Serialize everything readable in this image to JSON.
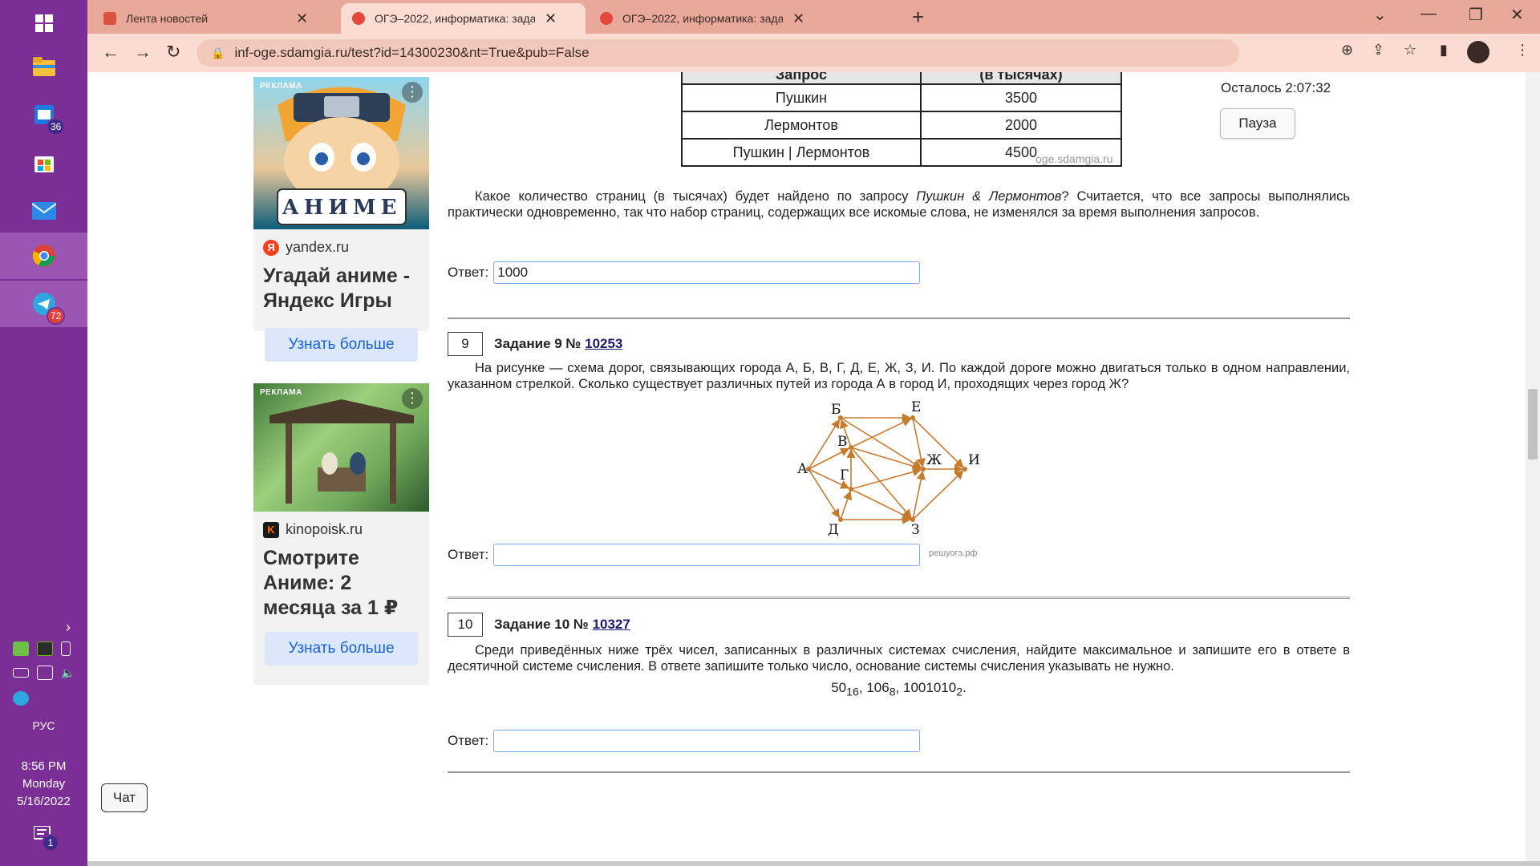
{
  "taskbar": {
    "mail_badge": "36",
    "telegram_badge": "72",
    "notification_badge": "1",
    "language": "РУС",
    "time": "8:56 PM",
    "day": "Monday",
    "date": "5/16/2022"
  },
  "browser": {
    "tabs": [
      {
        "title": "Лента новостей",
        "active": false
      },
      {
        "title": "ОГЭ–2022, информатика: задания",
        "active": true
      },
      {
        "title": "ОГЭ–2022, информатика: задания",
        "active": false
      }
    ],
    "url": "inf-oge.sdamgia.ru/test?id=14300230&nt=True&pub=False"
  },
  "ads": [
    {
      "tag": "РЕКЛАМА",
      "image_text": "АНИМЕ",
      "source": "yandex.ru",
      "title": "Угадай аниме - Яндекс Игры",
      "button": "Узнать больше"
    },
    {
      "tag": "РЕКЛАМА",
      "source": "kinopoisk.ru",
      "title": "Смотрите Аниме: 2 месяца за 1 ₽",
      "button": "Узнать больше"
    }
  ],
  "timer": {
    "label": "Осталось 2:07:32",
    "pause_button": "Пауза"
  },
  "task8": {
    "table_header": [
      "Запрос",
      "(в тысячах)"
    ],
    "rows": [
      [
        "Пушкин",
        "3500"
      ],
      [
        "Лермонтов",
        "2000"
      ],
      [
        "Пушкин | Лермонтов",
        "4500"
      ]
    ],
    "watermark": "oge.sdamgia.ru",
    "question_a": "Какое количество страниц (в тысячах) будет найдено по запросу ",
    "question_em": "Пушкин & Лермонтов",
    "question_b": "? Считается, что все запросы выполнялись практически одновременно, так что набор страниц, содержащих все искомые слова, не изменялся за время выполнения запросов.",
    "answer_label": "Ответ:",
    "answer_value": "1000"
  },
  "task9": {
    "number": "9",
    "title": "Задание 9 № ",
    "id": "10253",
    "text": "На рисунке — схема дорог, связывающих города А, Б, В, Г, Д, Е, Ж, З, И. По каждой дороге можно двигаться только в одном направлении, указанном стрелкой. Сколько существует различных путей из города А в город И, проходящих через город Ж?",
    "graph_nodes": [
      "А",
      "Б",
      "В",
      "Г",
      "Д",
      "Е",
      "Ж",
      "З",
      "И"
    ],
    "graph_edges": [
      [
        "А",
        "Б"
      ],
      [
        "А",
        "В"
      ],
      [
        "А",
        "Г"
      ],
      [
        "А",
        "Д"
      ],
      [
        "Б",
        "Е"
      ],
      [
        "Б",
        "Ж"
      ],
      [
        "В",
        "Б"
      ],
      [
        "В",
        "Ж"
      ],
      [
        "В",
        "З"
      ],
      [
        "В",
        "Е"
      ],
      [
        "Г",
        "В"
      ],
      [
        "Г",
        "Ж"
      ],
      [
        "Г",
        "З"
      ],
      [
        "Д",
        "Г"
      ],
      [
        "Д",
        "З"
      ],
      [
        "Е",
        "Ж"
      ],
      [
        "Е",
        "И"
      ],
      [
        "Ж",
        "И"
      ],
      [
        "З",
        "Ж"
      ],
      [
        "З",
        "И"
      ]
    ],
    "watermark": "решуогэ.рф",
    "edge_color": "#c77a2c",
    "answer_label": "Ответ:",
    "answer_value": ""
  },
  "task10": {
    "number": "10",
    "title": "Задание 10 № ",
    "id": "10327",
    "text": "Среди приведённых ниже трёх чисел, записанных в различных системах счисления, найдите максимальное и запишите его в ответе в десятичной системе счисления. В ответе запишите только число, основание системы счисления указывать не нужно.",
    "numbers": [
      {
        "value": "50",
        "base": "16"
      },
      {
        "value": "106",
        "base": "8"
      },
      {
        "value": "1001010",
        "base": "2"
      }
    ],
    "answer_label": "Ответ:",
    "answer_value": ""
  },
  "chat_button": "Чат"
}
